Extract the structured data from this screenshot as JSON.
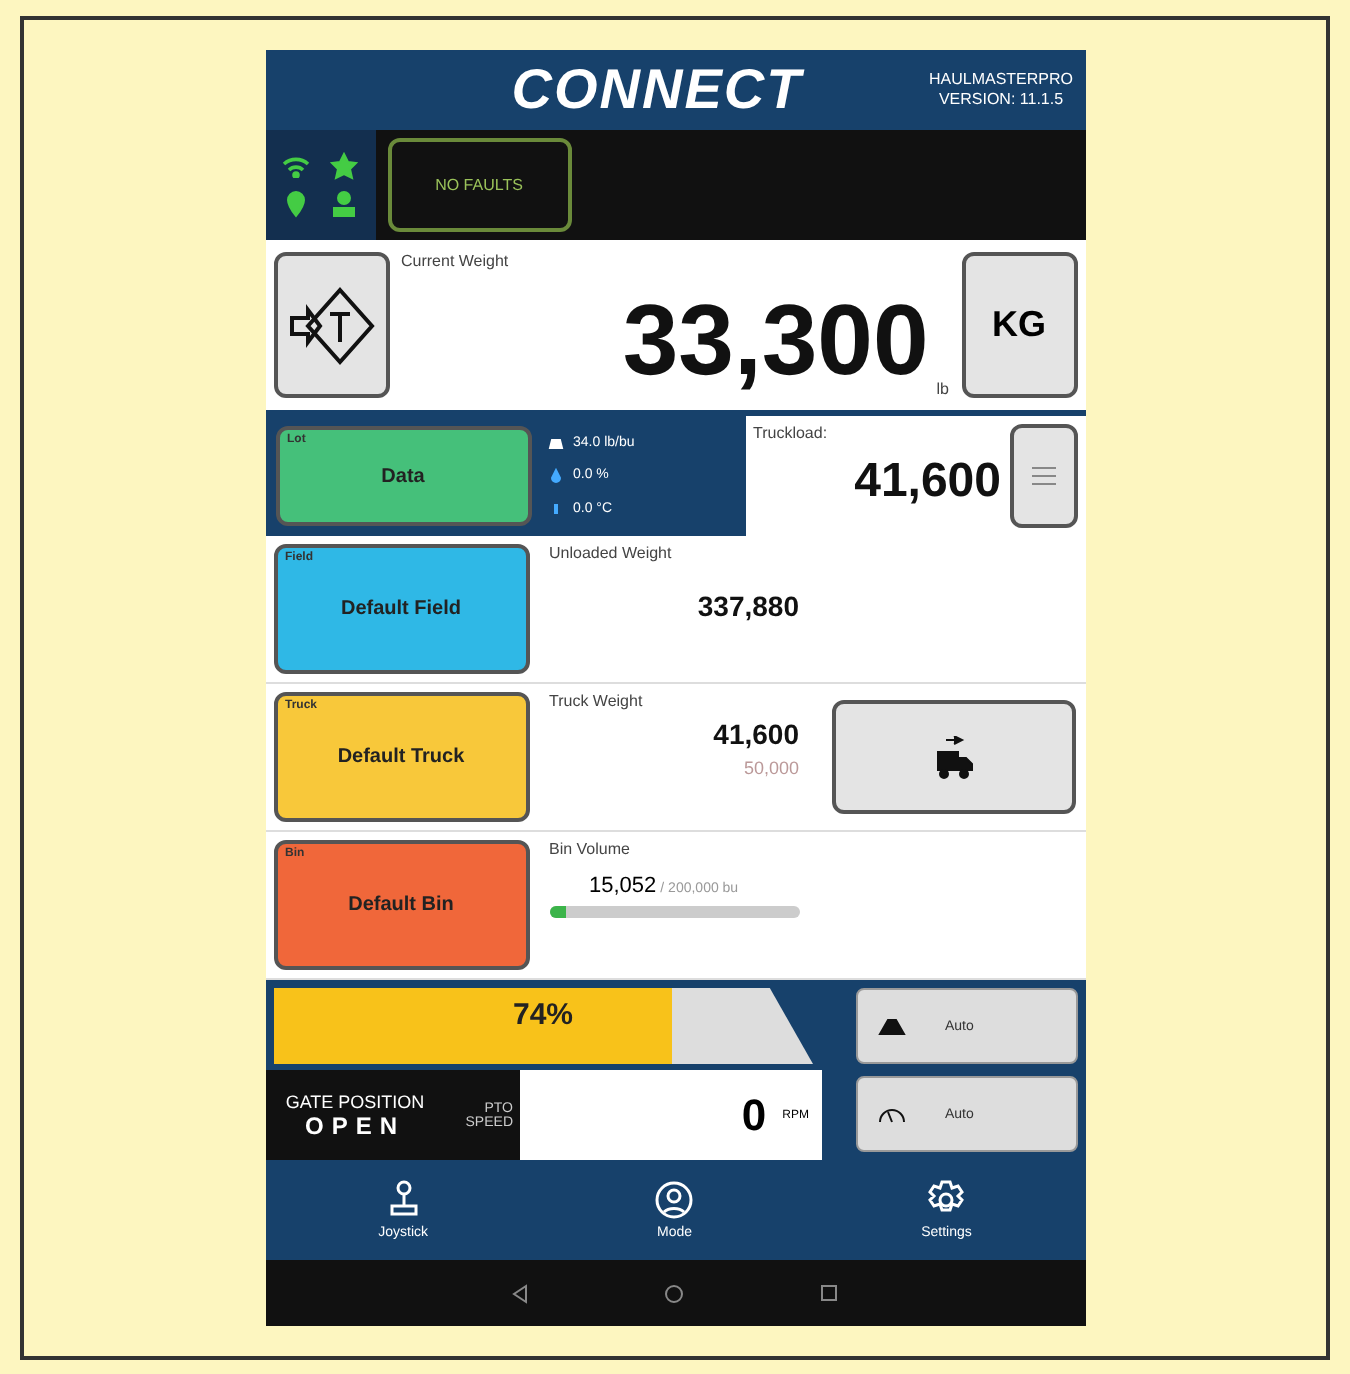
{
  "header": {
    "logo": "CONNECT",
    "product": "HAULMASTERPRO",
    "version": "VERSION: 11.1.5"
  },
  "status": {
    "faults": "NO FAULTS"
  },
  "weight": {
    "label": "Current Weight",
    "value": "33,300",
    "unit_small": "lb",
    "unit_button": "KG"
  },
  "data_panel": {
    "button": {
      "tag": "Lot",
      "label": "Data"
    },
    "readings": [
      {
        "kind": "scale",
        "text": "34.0 lb/bu"
      },
      {
        "kind": "drop",
        "text": "0.0 %"
      },
      {
        "kind": "thermo",
        "text": "0.0 °C"
      }
    ],
    "truckload": {
      "label": "Truckload:",
      "value": "41,600"
    }
  },
  "rows": [
    {
      "kind": "field",
      "tag": "Field",
      "button": "Default Field",
      "color": "#2fb8e6",
      "label": "Unloaded Weight",
      "value": "337,880"
    },
    {
      "kind": "truck",
      "tag": "Truck",
      "button": "Default Truck",
      "color": "#f8c83a",
      "label": "Truck Weight",
      "value": "41,600",
      "sub": "50,000"
    },
    {
      "kind": "bin",
      "tag": "Bin",
      "button": "Default Bin",
      "color": "#f0673a",
      "label": "Bin Volume",
      "value": "15,052",
      "capacity": " / 200,000 bu",
      "level": 0.07
    }
  ],
  "controls": {
    "fill": {
      "text": "74%",
      "level": 0.74
    },
    "gate": {
      "label": "GATE POSITION",
      "value": "OPEN"
    },
    "pto": {
      "label": "PTO SPEED",
      "value": "0",
      "unit": "RPM"
    },
    "auto_buttons": [
      {
        "kind": "weight",
        "label": "Auto"
      },
      {
        "kind": "gauge",
        "label": "Auto"
      }
    ]
  },
  "nav": [
    {
      "kind": "joystick",
      "label": "Joystick"
    },
    {
      "kind": "mode",
      "label": "Mode"
    },
    {
      "kind": "settings",
      "label": "Settings"
    }
  ]
}
